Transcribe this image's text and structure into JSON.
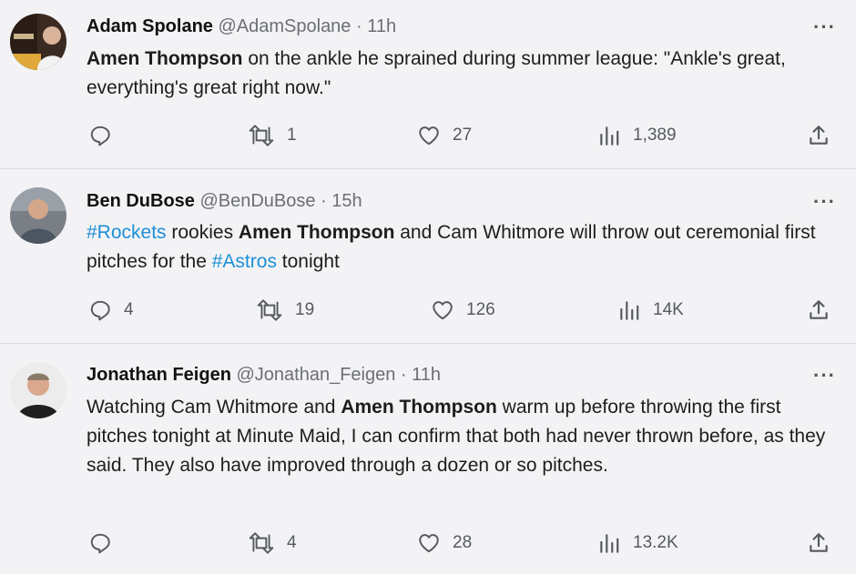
{
  "tweets": [
    {
      "name": "Adam Spolane",
      "handle": "@AdamSpolane",
      "time": "11h",
      "segments": [
        {
          "text": "Amen Thompson",
          "bold": true
        },
        {
          "text": " on the ankle he sprained during summer league: \"Ankle's great, everything's great right now.\""
        }
      ],
      "replies": "",
      "retweets": "1",
      "likes": "27",
      "views": "1,389"
    },
    {
      "name": "Ben DuBose",
      "handle": "@BenDuBose",
      "time": "15h",
      "segments": [
        {
          "text": "#Rockets",
          "hashtag": true
        },
        {
          "text": " rookies "
        },
        {
          "text": "Amen Thompson",
          "bold": true
        },
        {
          "text": " and Cam Whitmore will throw out ceremonial first pitches for the "
        },
        {
          "text": "#Astros",
          "hashtag": true
        },
        {
          "text": " tonight"
        }
      ],
      "replies": "4",
      "retweets": "19",
      "likes": "126",
      "views": "14K"
    },
    {
      "name": "Jonathan Feigen",
      "handle": "@Jonathan_Feigen",
      "time": "11h",
      "segments": [
        {
          "text": "Watching Cam Whitmore and "
        },
        {
          "text": "Amen Thompson",
          "bold": true
        },
        {
          "text": " warm up before throwing the first pitches tonight at Minute Maid, I can confirm that both had never thrown before, as they said. They also have improved through a dozen or so pitches."
        }
      ],
      "replies": "",
      "retweets": "4",
      "likes": "28",
      "views": "13.2K"
    }
  ],
  "separator": " · ",
  "more_label": "···",
  "icons": {
    "reply": "reply-icon",
    "retweet": "retweet-icon",
    "like": "heart-icon",
    "views": "views-icon",
    "share": "share-icon",
    "more": "more-icon"
  },
  "colors": {
    "background": "#f3f3f5",
    "hashtag": "#1d8fd8",
    "muted": "#6b6f73"
  }
}
